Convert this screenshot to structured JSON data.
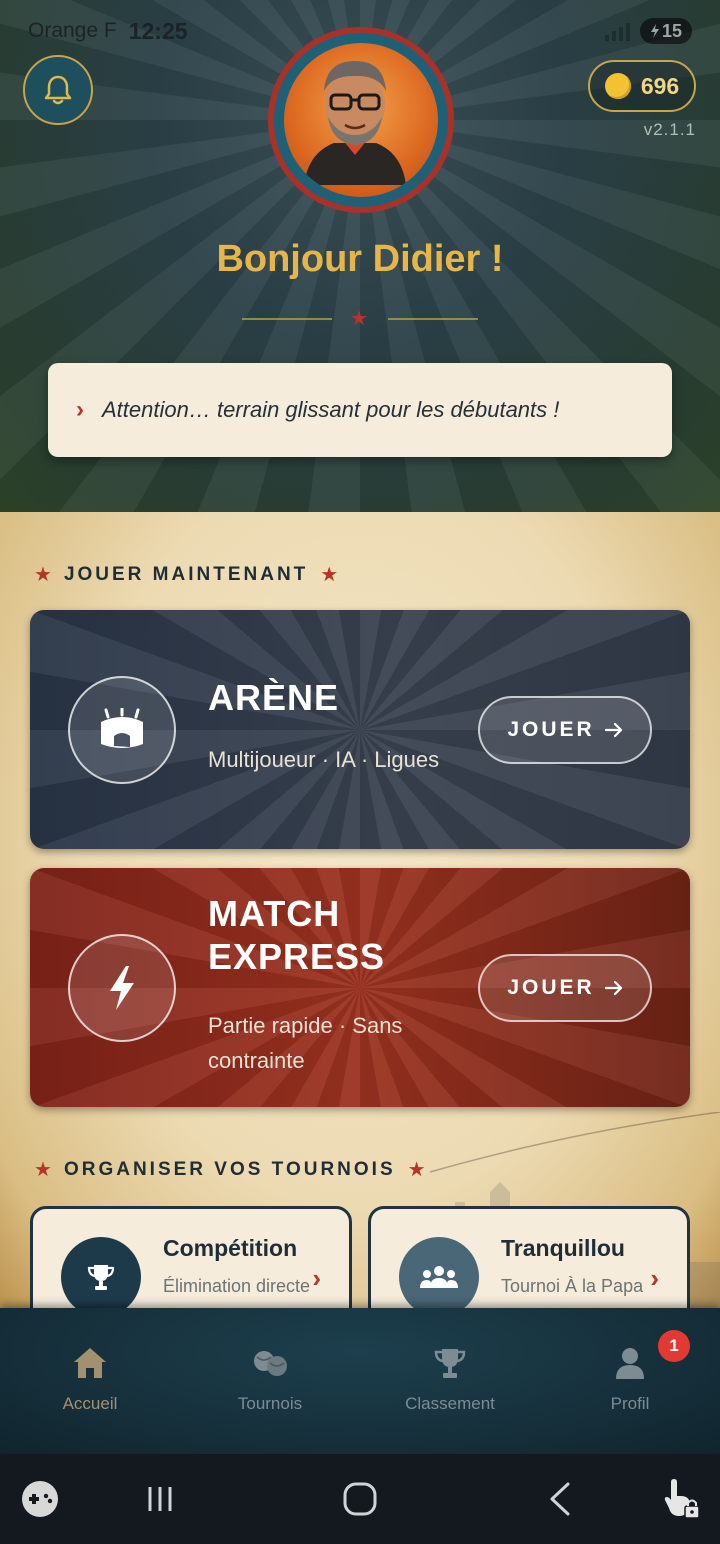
{
  "status_bar": {
    "carrier": "Orange F",
    "time": "12:25",
    "battery": "15"
  },
  "header": {
    "coins": "696",
    "version": "v2.1.1",
    "greeting": "Bonjour Didier !",
    "tip": "Attention… terrain glissant pour les débutants !"
  },
  "play_section": {
    "title": "JOUER MAINTENANT",
    "arena": {
      "title": "ARÈNE",
      "subtitle": "Multijoueur · IA · Ligues",
      "button": "JOUER"
    },
    "express": {
      "title": "MATCH EXPRESS",
      "subtitle": "Partie rapide · Sans contrainte",
      "button": "JOUER"
    }
  },
  "tournament_section": {
    "title": "ORGANISER VOS TOURNOIS",
    "competition": {
      "title": "Compétition",
      "subtitle": "Élimination directe"
    },
    "tranquillou": {
      "title": "Tranquillou",
      "subtitle": "Tournoi À la Papa"
    }
  },
  "bottom_nav": {
    "items": [
      {
        "label": "Accueil",
        "icon": "home-icon",
        "active": true
      },
      {
        "label": "Tournois",
        "icon": "petanque-balls-icon"
      },
      {
        "label": "Classement",
        "icon": "trophy-icon"
      },
      {
        "label": "Profil",
        "icon": "user-icon"
      }
    ],
    "profile_badge": "1"
  },
  "colors": {
    "gold": "#e8b648",
    "accent_red": "#b6352a",
    "arena_card": "#323a48",
    "express_card": "#9c3220",
    "parchment": "#f4e7c9",
    "nav_bg": "#16303b"
  }
}
